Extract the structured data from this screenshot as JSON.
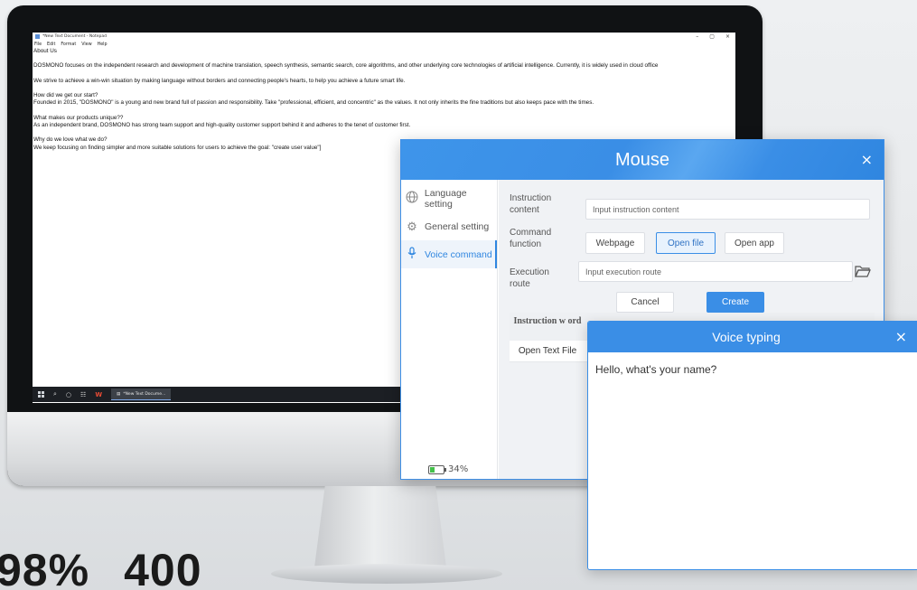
{
  "notepad": {
    "title": "*New Text Document - Notepad",
    "menu": [
      "File",
      "Edit",
      "Format",
      "View",
      "Help"
    ],
    "window_controls": [
      "–",
      "▢",
      "×"
    ],
    "lines": [
      "About Us",
      "",
      "DOSMONO focuses on the independent research and development of machine translation, speech synthesis, semantic search, core algorithms, and other underlying core technologies of artificial intelligence. Currently, it is widely used in cloud office",
      "",
      "We strive to achieve a win-win situation by making language without borders and connecting people's hearts, to help you achieve a future smart life.",
      "",
      "How did we get our start?",
      "Founded in 2015, \"DOSMONO\" is a young and new brand full of passion and responsibility. Take \"professional, efficient, and concentric\" as the values. It not only inherits the fine traditions but also keeps pace with the times.",
      "",
      "What makes our products unique??",
      "As an independent brand, DOSMONO has strong team support and high-quality customer support behind it and adheres to the tenet of customer first.",
      "",
      "Why do we love what we do?",
      "We keep focusing on finding simpler and more suitable solutions for users to achieve the goal: \"create user value\"]"
    ]
  },
  "taskbar": {
    "task_label": "*New Text Docume..."
  },
  "mouse_dialog": {
    "title": "Mouse",
    "close": "×",
    "sidebar": [
      {
        "label": "Language setting",
        "icon": "globe-icon",
        "active": false
      },
      {
        "label": "General setting",
        "icon": "gear-icon",
        "active": false
      },
      {
        "label": "Voice command",
        "icon": "microphone-icon",
        "active": true
      }
    ],
    "battery": {
      "text": "34%",
      "level": 0.34
    },
    "form": {
      "instruction_label": "Instruction content",
      "instruction_placeholder": "Input instruction content",
      "command_label": "Command function",
      "command_options": [
        "Webpage",
        "Open file",
        "Open app"
      ],
      "command_selected": "Open file",
      "route_label": "Execution route",
      "route_placeholder": "Input execution route",
      "cancel": "Cancel",
      "create": "Create"
    },
    "table": {
      "header": [
        "Instruction w ord"
      ],
      "rows": [
        [
          "Open Text File"
        ]
      ]
    }
  },
  "voice_typing": {
    "title": "Voice typing",
    "close": "×",
    "text": "Hello, what's your name?"
  },
  "stats": [
    "98%",
    "400"
  ],
  "colors": {
    "accent": "#3a8ee6",
    "battery_fill": "#45c04a"
  }
}
